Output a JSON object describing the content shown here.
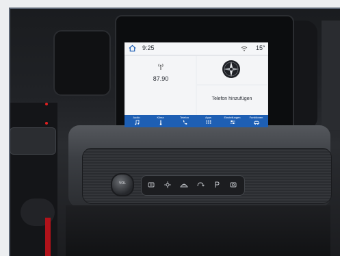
{
  "status": {
    "time": "9:25",
    "temperature": "15°"
  },
  "radio": {
    "frequency": "87.90"
  },
  "phone": {
    "add_label": "Telefon hinzufügen"
  },
  "nav": [
    {
      "label": "Audio",
      "icon": "music-note-icon"
    },
    {
      "label": "Klima",
      "icon": "thermometer-icon"
    },
    {
      "label": "Telefon",
      "icon": "phone-icon"
    },
    {
      "label": "Apps",
      "icon": "apps-grid-icon"
    },
    {
      "label": "Einstellungen",
      "icon": "settings-sliders-icon"
    },
    {
      "label": "Funktionen",
      "icon": "vehicle-icon"
    }
  ],
  "dash": {
    "vol_label": "VOL",
    "buttons": [
      {
        "icon": "rear-defrost-icon"
      },
      {
        "icon": "auto-fan-icon"
      },
      {
        "icon": "front-defrost-icon"
      },
      {
        "icon": "recirculation-icon"
      },
      {
        "icon": "parking-icon"
      },
      {
        "icon": "camera-icon"
      }
    ]
  },
  "colors": {
    "nav_bar": "#1e5fb4",
    "screen_bg": "#eef0f3"
  }
}
